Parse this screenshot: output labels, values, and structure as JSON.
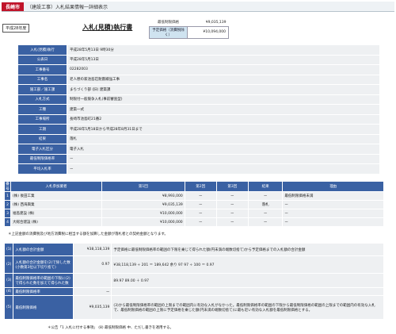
{
  "header": {
    "city": "長崎市",
    "title": "（建設工事）入札結果情報一詳細表示"
  },
  "era_badge": "平成28年度",
  "document_title": "入札(見積)執行書",
  "price_box": {
    "min_label": "最低制限価格",
    "min_value": "¥9,035,139",
    "planned_label": "予定価格（消費税除く）",
    "planned_value": "¥10,094,000"
  },
  "info_rows": [
    {
      "key": "入札(見積)執行",
      "value": "平成28年5月13日 9時30分"
    },
    {
      "key": "公表日",
      "value": "平成28年5月13日"
    },
    {
      "key": "工事番号",
      "value": "02282003"
    },
    {
      "key": "工事名",
      "value": "老人憩の家池島荘耐震補強工事"
    },
    {
      "key": "施工部／施工課",
      "value": "まちづくり部 (旧) 建築課"
    },
    {
      "key": "入札方式",
      "value": "制限付一般競争入札(事前審査型)"
    },
    {
      "key": "工種",
      "value": "建築一式"
    },
    {
      "key": "工事場所",
      "value": "長崎市池島町21番2"
    },
    {
      "key": "工期",
      "value": "平成28年5月18日から平成28年8月31日まで"
    },
    {
      "key": "結果",
      "value": "落札"
    },
    {
      "key": "電子入札区分",
      "value": "電子入札"
    },
    {
      "key": "最低制限価格率",
      "value": "ー"
    },
    {
      "key": "平均入札率",
      "value": "ー"
    }
  ],
  "bid_table": {
    "headers": [
      "番号",
      "入札参加業者",
      "第1回",
      "第2回",
      "第3回",
      "結果",
      "理由"
    ],
    "rows": [
      {
        "no": "1",
        "name": "(株) 後田工業",
        "r1": "¥8,993,000",
        "r2": "ー",
        "r3": "ー",
        "result": "ー",
        "reason": "最低制限価格未満"
      },
      {
        "no": "2",
        "name": "(株) 西海興業",
        "r1": "¥9,035,139",
        "r2": "ー",
        "r3": "ー",
        "result": "落札",
        "reason": "ー"
      },
      {
        "no": "3",
        "name": "福島建設 (株)",
        "r1": "¥10,000,000",
        "r2": "ー",
        "r3": "ー",
        "result": "ー",
        "reason": "ー"
      },
      {
        "no": "4",
        "name": "大総合建設 (株)",
        "r1": "¥10,000,000",
        "r2": "ー",
        "r3": "ー",
        "result": "ー",
        "reason": "ー"
      }
    ]
  },
  "note1": "＊上記金額の消費税及び地方消費税に相当する額を加算した金額が落札者との契約金額となります。",
  "calc_rows": [
    {
      "no": "(1)",
      "key": "入札額の合計金額",
      "val": "¥38,118,139",
      "desc": "予定価格に最低制限価格率の範囲の下限を乗じて得られた額(円未満の端数切捨て)から予定価格までの入札額の合計金額"
    },
    {
      "no": "(2)",
      "key": "入札額の合計金額を(2)で除した数(小数第3位以下切り捨て)",
      "val": "0.97",
      "desc": "¥38,118,139 ÷ 201 ＝ 189,642 余り 97    97 ÷ 100 ＝ 0.97"
    },
    {
      "no": "(3)",
      "key": "最低制限価格率の範囲の下限に(2)で得られた数を加えて得られた数",
      "val": "",
      "desc": "89.97 89.00 ＋ 0.97"
    },
    {
      "no": "(4)",
      "key": "最低制限価格率",
      "val": "ー",
      "desc": ""
    },
    {
      "no": "(5)",
      "key": "最低制限価格",
      "val": "¥9,035,139",
      "desc": "(3)から最低制限価格率の範囲の上限までの範囲内に有効な入札がなかった。最低制限価格率の範囲の下限から最低制限価格の範囲の上限までの範囲内の有効な入札で、最低制限価格の範囲の上限に予定価格を乗じた額(円未満の端数切捨て)に最も近い有効な入札額を最低制限価格とする。"
    }
  ],
  "note2": "＊公告「1 入札に付する事項」 (8) 最低制限価格 中、ただし書きを適用する。"
}
